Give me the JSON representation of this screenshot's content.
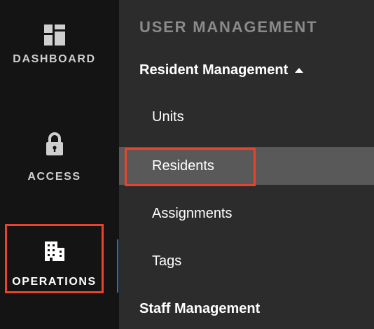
{
  "rail": {
    "items": [
      {
        "label": "DASHBOARD",
        "icon": "dashboard-icon"
      },
      {
        "label": "ACCESS",
        "icon": "lock-icon"
      },
      {
        "label": "OPERATIONS",
        "icon": "building-icon",
        "selected": true
      }
    ]
  },
  "panel": {
    "section_title": "USER MANAGEMENT",
    "groups": [
      {
        "label": "Resident Management",
        "expanded": true,
        "items": [
          {
            "label": "Units"
          },
          {
            "label": "Residents",
            "active": true
          },
          {
            "label": "Assignments"
          },
          {
            "label": "Tags"
          }
        ]
      },
      {
        "label": "Staff Management",
        "expanded": false
      }
    ]
  },
  "colors": {
    "rail_bg": "#141414",
    "panel_bg": "#2c2c2c",
    "active_item_bg": "#595959",
    "highlight_border": "#e8432b",
    "accent_line": "#2f6fcc"
  }
}
